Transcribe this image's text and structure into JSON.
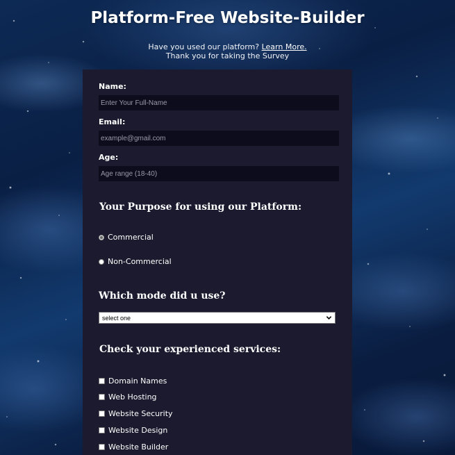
{
  "header": {
    "title": "Platform-Free Website-Builder",
    "intro_question": "Have you used our platform? ",
    "learn_more": "Learn More.",
    "thanks": "Thank you for taking the Survey"
  },
  "form": {
    "name_label": "Name:",
    "name_placeholder": "Enter Your Full-Name",
    "email_label": "Email:",
    "email_placeholder": "example@gmail.com",
    "age_label": "Age:",
    "age_placeholder": "Age range (18-40)",
    "purpose_heading": "Your Purpose for using our Platform:",
    "purpose_options": [
      "Commercial",
      "Non-Commercial"
    ],
    "purpose_selected": "Commercial",
    "mode_heading": "Which mode did u use?",
    "mode_select_value": "select one",
    "services_heading": "Check your experienced services:",
    "services": [
      "Domain Names",
      "Web Hosting",
      "Website Security",
      "Website Design",
      "Website Builder"
    ]
  },
  "colors": {
    "panel_bg": "#1b1a2e",
    "input_bg": "#0c0c1d",
    "text": "#ffffff"
  }
}
